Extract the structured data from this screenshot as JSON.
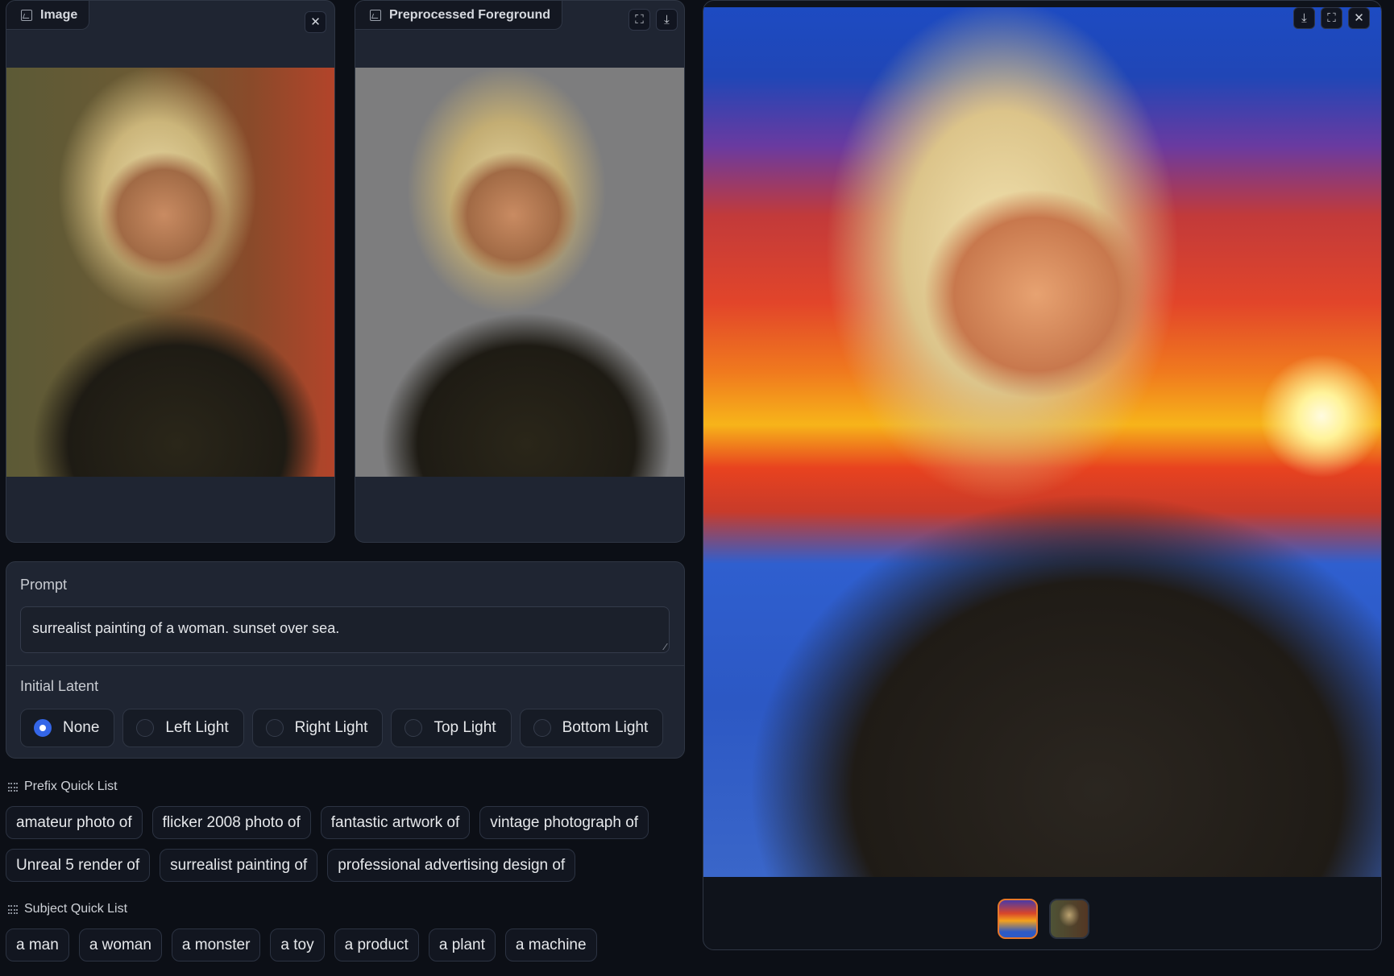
{
  "input_panel": {
    "label": "Image",
    "icon": "image-icon",
    "actions": [
      {
        "name": "close",
        "icon": "close-icon",
        "glyph": "✕"
      }
    ]
  },
  "foreground_panel": {
    "label": "Preprocessed Foreground",
    "icon": "image-icon",
    "actions": [
      {
        "name": "fullscreen",
        "icon": "fullscreen-icon",
        "glyph": "⛶"
      },
      {
        "name": "download",
        "icon": "download-icon",
        "glyph": "⤓"
      }
    ]
  },
  "prompt": {
    "label": "Prompt",
    "value": "surrealist painting of a woman. sunset over sea."
  },
  "initial_latent": {
    "label": "Initial Latent",
    "selected": "None",
    "options": [
      "None",
      "Left Light",
      "Right Light",
      "Top Light",
      "Bottom Light"
    ]
  },
  "prefix_quick_list": {
    "title": "Prefix Quick List",
    "row1": [
      "amateur photo of",
      "flicker 2008 photo of",
      "fantastic artwork of",
      "vintage photograph of"
    ],
    "row2": [
      "Unreal 5 render of",
      "surrealist painting of",
      "professional advertising design of"
    ]
  },
  "subject_quick_list": {
    "title": "Subject Quick List",
    "items": [
      "a man",
      "a woman",
      "a monster",
      "a toy",
      "a product",
      "a plant",
      "a machine"
    ]
  },
  "gallery": {
    "actions": [
      {
        "name": "download",
        "icon": "download-icon",
        "glyph": "⤓"
      },
      {
        "name": "fullscreen",
        "icon": "fullscreen-icon",
        "glyph": "⛶"
      },
      {
        "name": "close",
        "icon": "close-icon",
        "glyph": "✕"
      }
    ],
    "thumbnail_count": 2,
    "selected_index": 0,
    "accent_color": "#e8782a"
  },
  "colors": {
    "background": "#0c0f16",
    "panel": "#1f2532",
    "radio_selected": "#3466e8"
  }
}
